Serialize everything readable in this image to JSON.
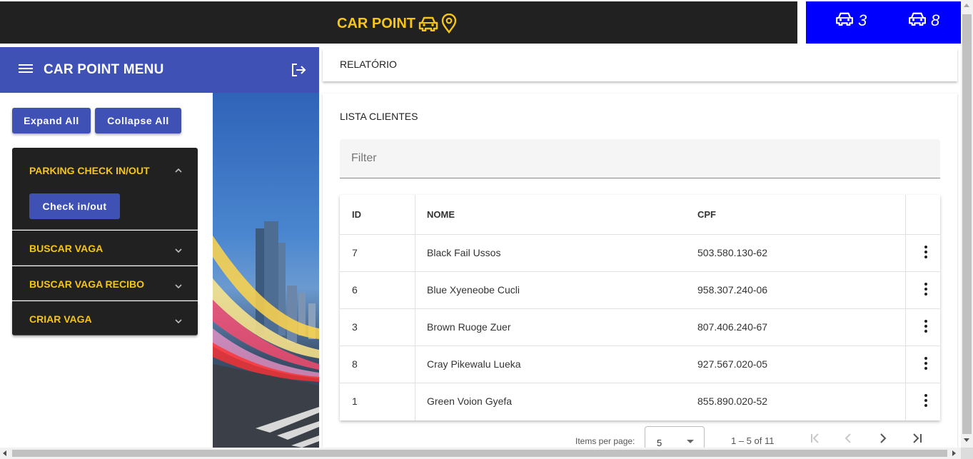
{
  "header": {
    "brand": "CAR POINT",
    "brand_icons": [
      "car-icon",
      "location-pin-icon"
    ],
    "brand_color": "#f5c518",
    "stats": [
      {
        "icon": "car-icon",
        "value": "3"
      },
      {
        "icon": "car-icon",
        "value": "8"
      }
    ],
    "stats_background": "#0000ff"
  },
  "sidebar": {
    "menu_title": "CAR POINT MENU",
    "menu_icon": "hamburger-icon",
    "logout_icon": "logout-icon",
    "expand_all": "Expand All",
    "collapse_all": "Collapse All",
    "panels": [
      {
        "title": "PARKING CHECK IN/OUT",
        "expanded": true,
        "button": "Check in/out"
      },
      {
        "title": "BUSCAR VAGA",
        "expanded": false
      },
      {
        "title": "BUSCAR VAGA RECIBO",
        "expanded": false
      },
      {
        "title": "CRIAR VAGA",
        "expanded": false
      }
    ],
    "accent": "#3f51b5"
  },
  "main": {
    "report_title": "RELATÓRIO",
    "list_title": "LISTA CLIENTES",
    "filter_placeholder": "Filter",
    "table": {
      "columns": [
        "ID",
        "NOME",
        "CPF"
      ],
      "rows": [
        {
          "id": "7",
          "nome": "Black Fail Ussos",
          "cpf": "503.580.130-62"
        },
        {
          "id": "6",
          "nome": "Blue Xyeneobe Cucli",
          "cpf": "958.307.240-06"
        },
        {
          "id": "3",
          "nome": "Brown Ruoge Zuer",
          "cpf": "807.406.240-67"
        },
        {
          "id": "8",
          "nome": "Cray Pikewalu Lueka",
          "cpf": "927.567.020-05"
        },
        {
          "id": "1",
          "nome": "Green Voion Gyefa",
          "cpf": "855.890.020-52"
        }
      ]
    },
    "paginator": {
      "items_per_page_label": "Items per page:",
      "items_per_page": "5",
      "range": "1 – 5 of 11"
    }
  }
}
